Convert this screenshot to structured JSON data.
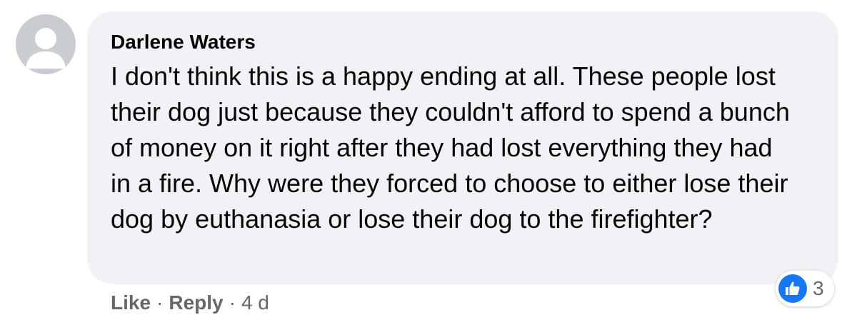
{
  "comment": {
    "author": "Darlene Waters",
    "text": "I don't think this is a happy ending at all. These people lost their dog just because they couldn't afford to spend a bunch of money on it right after they had lost everything they had in a fire. Why were they forced to choose to either lose their dog by euthanasia or lose their dog to the firefighter?",
    "reactions": {
      "icon": "like-thumbs-up-icon",
      "count": "3",
      "color": "#1877f2"
    },
    "actions": {
      "like_label": "Like",
      "reply_label": "Reply",
      "separator": "·",
      "timestamp": "4 d"
    }
  },
  "colors": {
    "bubble_bg": "#f0f2f5",
    "text": "#050505",
    "secondary_text": "#65676b",
    "avatar_bg": "#c9ccd1"
  }
}
